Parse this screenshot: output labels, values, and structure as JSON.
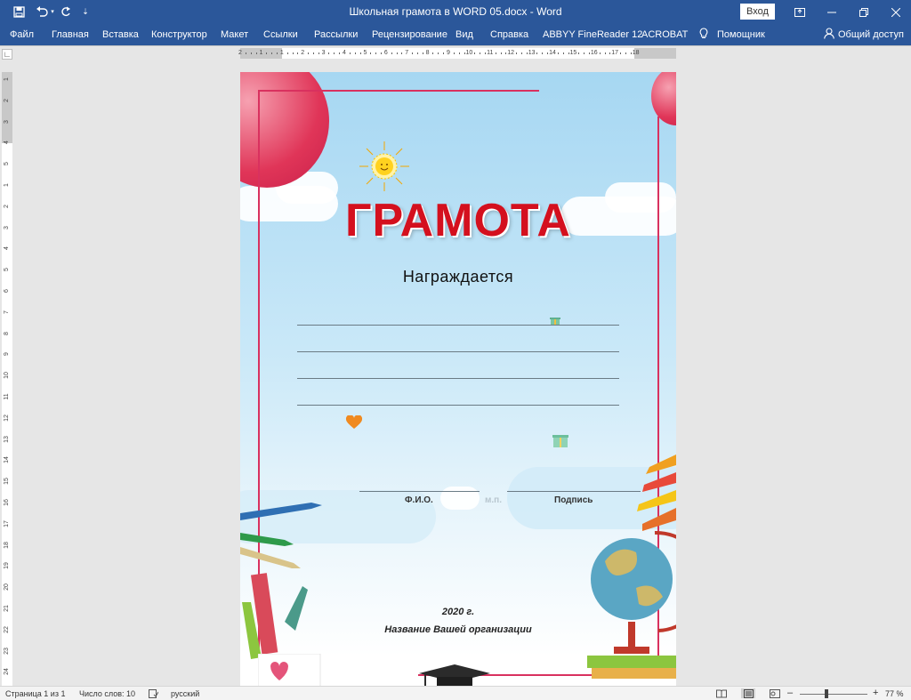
{
  "window": {
    "title": "Школьная грамота в WORD 05.docx  -  Word",
    "signin_label": "Вход"
  },
  "quick_access": {
    "save_icon": "save-icon",
    "undo_icon": "undo-icon",
    "redo_icon": "redo-icon",
    "customize_icon": "customize-icon"
  },
  "ribbon": {
    "tabs": [
      "Файл",
      "Главная",
      "Вставка",
      "Конструктор",
      "Макет",
      "Ссылки",
      "Рассылки",
      "Рецензирование",
      "Вид",
      "Справка",
      "ABBYY FineReader 12",
      "ACROBAT",
      "Помощник"
    ],
    "share_label": "Общий доступ"
  },
  "ruler": {
    "horizontal_ticks": [
      "2",
      "1",
      "1",
      "2",
      "3",
      "4",
      "5",
      "6",
      "7",
      "8",
      "9",
      "10",
      "11",
      "12",
      "13",
      "14",
      "15",
      "16",
      "17",
      "18"
    ],
    "vertical_ticks": [
      "1",
      "2",
      "3",
      "4",
      "5",
      "1",
      "2",
      "3",
      "4",
      "5",
      "6",
      "7",
      "8",
      "9",
      "10",
      "11",
      "12",
      "13",
      "14",
      "15",
      "16",
      "17",
      "18",
      "19",
      "20",
      "21",
      "22",
      "23",
      "24"
    ]
  },
  "document": {
    "title": "ГРАМОТА",
    "subtitle": "Награждается",
    "fio_label": "Ф.И.О.",
    "stamp_label": "м.п.",
    "signature_label": "Подпись",
    "year": "2020 г.",
    "organization": "Название Вашей организации"
  },
  "statusbar": {
    "page_info": "Страница 1 из 1",
    "word_count": "Число слов: 10",
    "language": "русский",
    "zoom_minus": "–",
    "zoom_plus": "+",
    "zoom_level": "77 %",
    "zoom_percent": 77
  },
  "colors": {
    "ribbon": "#2b579a",
    "title_red": "#d4101e",
    "frame": "#d9315f"
  }
}
